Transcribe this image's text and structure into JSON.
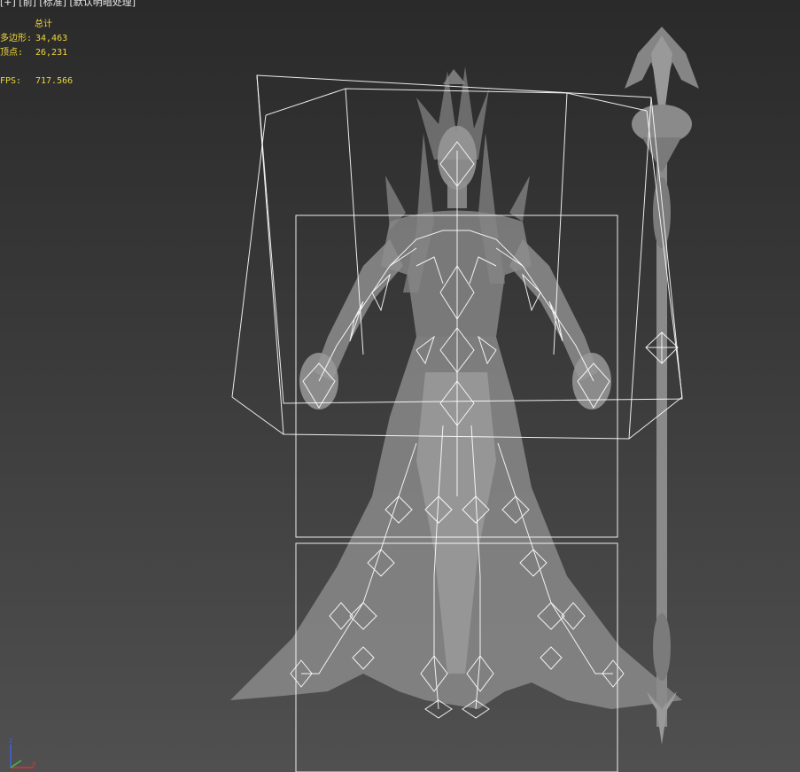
{
  "viewport": {
    "label": "[+] [前] [标准] [默认明暗处理]"
  },
  "stats": {
    "title": "总计",
    "polygons_label": "多边形:",
    "polygons_value": "34,463",
    "vertices_label": "顶点:",
    "vertices_value": "26,231",
    "fps_label": "FPS:",
    "fps_value": "717.566"
  },
  "axis_gizmo": {
    "z_label": "z",
    "x_label": "x",
    "colors": {
      "x": "#e03030",
      "z": "#4060e0",
      "y": "#40c040"
    }
  },
  "colors": {
    "model": "#8a8a8a",
    "wire": "#ffffff"
  }
}
